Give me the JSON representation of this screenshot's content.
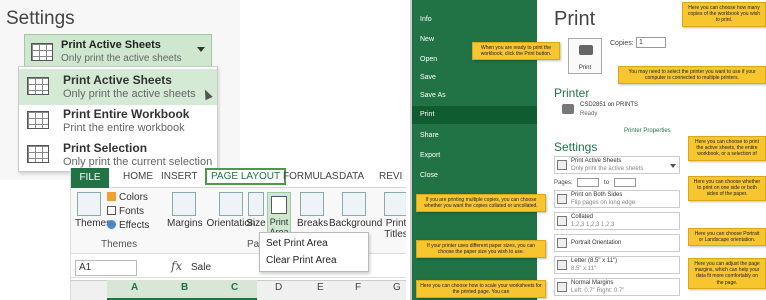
{
  "settings": {
    "title": "Settings",
    "current": {
      "label": "Print Active Sheets",
      "sub": "Only print the active sheets"
    },
    "options": [
      {
        "label": "Print Active Sheets",
        "sub": "Only print the active sheets"
      },
      {
        "label": "Print Entire Workbook",
        "sub": "Print the entire workbook"
      },
      {
        "label": "Print Selection",
        "sub": "Only print the current selection"
      }
    ]
  },
  "ribbon": {
    "tabs": [
      "FILE",
      "HOME",
      "INSERT",
      "PAGE LAYOUT",
      "FORMULAS",
      "DATA",
      "REVI"
    ],
    "themes": "Themes",
    "colors": "Colors",
    "fonts": "Fonts",
    "effects": "Effects",
    "themes_group": "Themes",
    "margins": "Margins",
    "orientation": "Orientation",
    "size": "Size",
    "print_area": "Print Area",
    "breaks": "Breaks",
    "background": "Background",
    "print_titles": "Print Titles",
    "page_group": "Pag",
    "menu": [
      "Set Print Area",
      "Clear Print Area"
    ],
    "namebox": "A1",
    "formula_value": "Sale",
    "columns": [
      "A",
      "B",
      "C",
      "D",
      "E",
      "F",
      "G"
    ]
  },
  "backstage": {
    "nav": [
      "Info",
      "New",
      "Open",
      "Save",
      "Save As",
      "Print",
      "Share",
      "Export",
      "Close"
    ],
    "print_title": "Print",
    "print_button": "Print",
    "copies_label": "Copies:",
    "copies_value": "1",
    "printer_title": "Printer",
    "printer_name": "CSD2851 on PRINTS",
    "printer_status": "Ready",
    "printer_properties": "Printer Properties",
    "settings_title": "Settings",
    "pages_label": "Pages:",
    "pages_to": "to",
    "rows": [
      {
        "t1": "Print Active Sheets",
        "t2": "Only print the active sheets"
      },
      {
        "t1": "Print on Both Sides",
        "t2": "Flip pages on long edge"
      },
      {
        "t1": "Collated",
        "t2": "1,2,3   1,2,3   1,2,3"
      },
      {
        "t1": "Portrait Orientation",
        "t2": ""
      },
      {
        "t1": "Letter (8.5\" x 11\")",
        "t2": "8.5\" x 11\""
      },
      {
        "t1": "Normal Margins",
        "t2": "Left: 0.7\"   Right: 0.7\""
      }
    ],
    "notes": [
      "Here you can choose how many copies of the workbook you wish to print.",
      "When you are ready to print the workbook, click the Print button.",
      "You may need to select the printer you want to use if your computer is connected to multiple printers.",
      "Here you can choose to print the active sheets, the entire workbook, or a selection of",
      "Here you can choose whether to print on one side or both sides of the paper.",
      "If you are printing multiple copies, you can choose whether you want the copies collated or uncollated.",
      "Here you can choose Portrait or Landscape orientation.",
      "If your printer uses different paper sizes, you can choose the paper size you wish to use.",
      "Here you can adjust the page margins, which can help your data fit more comfortably on the page.",
      "Here you can choose how to scale your worksheets for the printed page. You can"
    ]
  }
}
